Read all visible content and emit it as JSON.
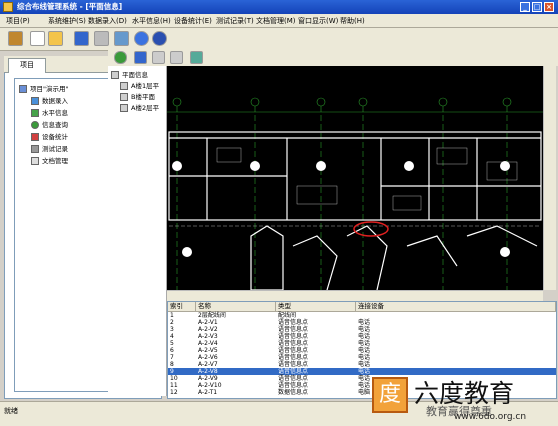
{
  "window": {
    "title": "综合布线管理系统 - [平面信息]"
  },
  "menu": [
    "项目(P)",
    "系统维护(S)",
    "数据录入(D)",
    "水平信息(H)",
    "设备统计(E)",
    "测试记录(T)",
    "文档管理(M)",
    "窗口显示(W)",
    "帮助(H)"
  ],
  "left_panel": {
    "tab": "项目",
    "root": "项目\"演示用\"",
    "items": [
      "数据录入",
      "水平信息",
      "信息查询",
      "设备统计",
      "测试记录",
      "文档管理"
    ]
  },
  "floor_tree": {
    "root": "平面信息",
    "items": [
      "A楼1层平",
      "B楼平面",
      "A楼2层平"
    ]
  },
  "table": {
    "columns": [
      "索引",
      "名称",
      "类型",
      "连接设备"
    ],
    "rows": [
      [
        "1",
        "2层配线间",
        "配线间",
        ""
      ],
      [
        "2",
        "A-2-V1",
        "语音信息点",
        "电话"
      ],
      [
        "3",
        "A-2-V2",
        "语音信息点",
        "电话"
      ],
      [
        "4",
        "A-2-V3",
        "语音信息点",
        "电话"
      ],
      [
        "5",
        "A-2-V4",
        "语音信息点",
        "电话"
      ],
      [
        "6",
        "A-2-V5",
        "语音信息点",
        "电话"
      ],
      [
        "7",
        "A-2-V6",
        "语音信息点",
        "电话"
      ],
      [
        "8",
        "A-2-V7",
        "语音信息点",
        "电话"
      ],
      [
        "9",
        "A-2-V8",
        "语音信息点",
        "电话"
      ],
      [
        "10",
        "A-2-V9",
        "语音信息点",
        "电话"
      ],
      [
        "11",
        "A-2-V10",
        "语音信息点",
        "电话"
      ],
      [
        "12",
        "A-2-T1",
        "数据信息点",
        "电脑"
      ]
    ],
    "selected_row": 8
  },
  "status": {
    "text": "就绪"
  },
  "watermark": {
    "brand": "六度教育",
    "slogan": "教育赢得尊重",
    "url": "www.6do.org.cn",
    "logo_char": "度"
  },
  "colors": {
    "titlebar": "#1f55cc",
    "cad_bg": "#000000",
    "selection": "#316ac5",
    "highlight_ellipse": "#e02020"
  }
}
